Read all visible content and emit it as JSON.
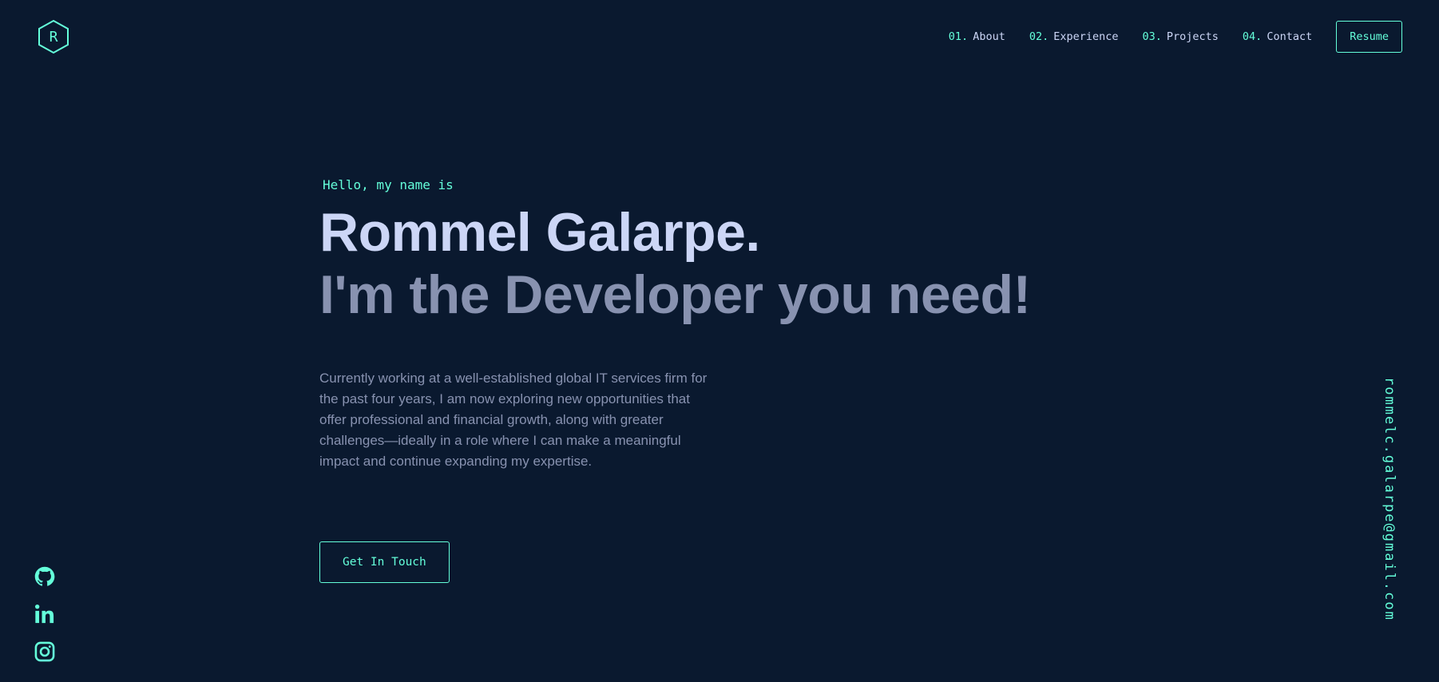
{
  "logo": {
    "letter": "R",
    "icon": "hexagon-logo-icon"
  },
  "nav": {
    "items": [
      {
        "num": "01.",
        "label": "About"
      },
      {
        "num": "02.",
        "label": "Experience"
      },
      {
        "num": "03.",
        "label": "Projects"
      },
      {
        "num": "04.",
        "label": "Contact"
      }
    ],
    "resume_label": "Resume"
  },
  "hero": {
    "greeting": "Hello, my name is",
    "name": "Rommel Galarpe.",
    "tagline": "I'm the Developer you need!",
    "description": "Currently working at a well-established global IT services firm for the past four years, I am now exploring new opportunities that offer professional and financial growth, along with greater challenges—ideally in a role where I can make a meaningful impact and continue expanding my expertise.",
    "cta_label": "Get In Touch"
  },
  "socials": [
    {
      "icon": "github-icon"
    },
    {
      "icon": "linkedin-icon"
    },
    {
      "icon": "instagram-icon"
    }
  ],
  "email": "rommelc.galarpe@gmail.com",
  "colors": {
    "background": "#0a192f",
    "accent": "#64ffda",
    "heading": "#ccd6f6",
    "text": "#8892b0"
  }
}
